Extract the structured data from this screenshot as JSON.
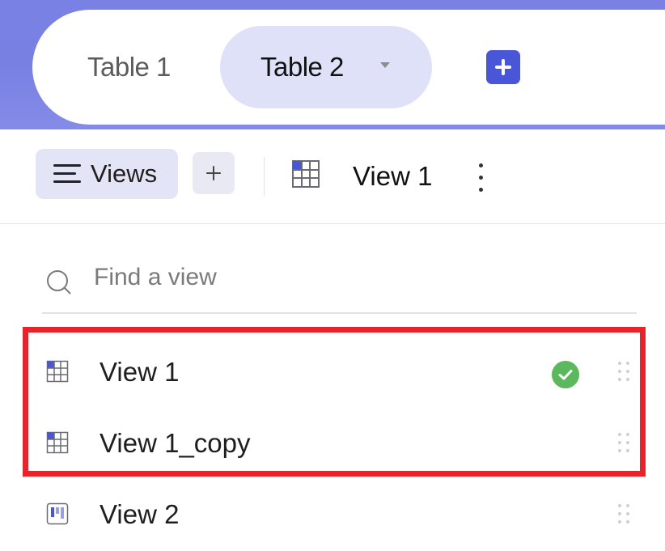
{
  "tabs": [
    {
      "label": "Table 1",
      "active": false
    },
    {
      "label": "Table 2",
      "active": true
    }
  ],
  "toolbar": {
    "views_label": "Views",
    "current_view": "View 1"
  },
  "search": {
    "placeholder": "Find a view",
    "value": ""
  },
  "views": [
    {
      "label": "View 1",
      "icon": "grid-view-icon",
      "selected": true
    },
    {
      "label": "View 1_copy",
      "icon": "grid-view-icon",
      "selected": false
    },
    {
      "label": "View 2",
      "icon": "kanban-view-icon",
      "selected": false
    }
  ],
  "colors": {
    "accent": "#4a56d8",
    "header_band": "#6f78e2",
    "active_tab": "#dfe1f8",
    "success": "#5cb85c",
    "highlight": "#e8232a"
  }
}
